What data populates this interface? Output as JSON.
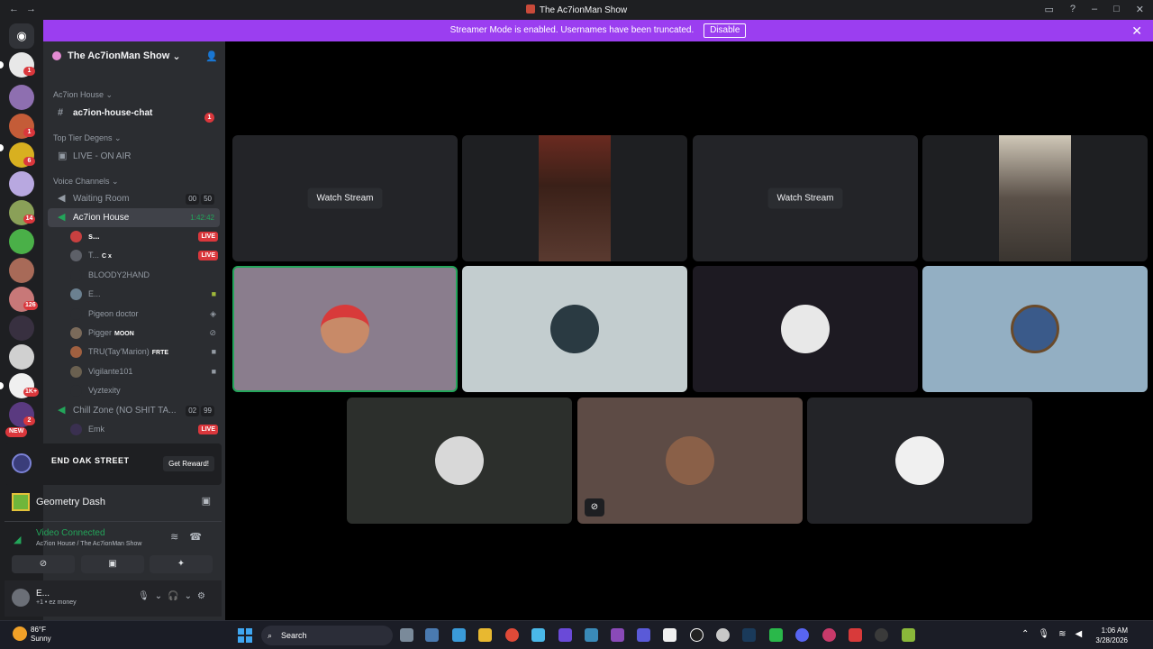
{
  "window": {
    "title": "The Ac7ionMan Show",
    "nav_back": "←",
    "nav_fwd": "→"
  },
  "banner": {
    "message": "Streamer Mode is enabled. Usernames have been truncated.",
    "button": "Disable",
    "close": "✕"
  },
  "rail": {
    "badges": [
      "1",
      "1",
      "6",
      "14",
      "126",
      "1K+",
      "2"
    ],
    "new_label": "NEW"
  },
  "server": {
    "name": "The Ac7ionMan Show",
    "chevron": "⌄"
  },
  "categories": {
    "house": "Ac7ion House",
    "top": "Top Tier Degens",
    "voice": "Voice Channels"
  },
  "channels": {
    "house_chat": {
      "name": "ac7ion-house-chat",
      "unread": "1"
    },
    "live_on_air": "LIVE - ON AIR",
    "waiting": {
      "name": "Waiting Room",
      "count": "00",
      "limit": "50"
    },
    "active": {
      "name": "Ac7ion House",
      "timer": "1:42:42"
    },
    "chill": {
      "name": "Chill Zone (NO SHIT TA...",
      "count": "02",
      "limit": "99"
    }
  },
  "voice_users": [
    {
      "name": "s...",
      "tag": "",
      "live": "LIVE"
    },
    {
      "name": "T...",
      "tag": "C x",
      "live": "LIVE"
    },
    {
      "name": "BLOODY2HAND",
      "tag": "",
      "live": ""
    },
    {
      "name": "E...",
      "tag": "",
      "live": ""
    },
    {
      "name": "Pigeon doctor",
      "tag": "",
      "live": ""
    },
    {
      "name": "Pigger",
      "tag": "MOON",
      "live": ""
    },
    {
      "name": "TRU(Tay'Marion)",
      "tag": "FRTE",
      "live": ""
    },
    {
      "name": "Vigilante101",
      "tag": "",
      "live": ""
    },
    {
      "name": "Vyztexity",
      "tag": "",
      "live": ""
    }
  ],
  "chill_users": [
    {
      "name": "Emk",
      "live": "LIVE"
    }
  ],
  "promo": {
    "brand": "END OAK STREET",
    "button": "Get Reward!"
  },
  "game": {
    "name": "Geometry Dash"
  },
  "voice_status": {
    "label": "Video Connected",
    "location": "Ac7ion House / The Ac7ionMan Show"
  },
  "user_panel": {
    "name": "E...",
    "status": "+1 • ez money"
  },
  "stage": {
    "watch_label": "Watch Stream"
  },
  "taskbar": {
    "temp": "86°F",
    "weather": "Sunny",
    "search": "Search",
    "time": "1:06 AM",
    "date": "3/28/2026"
  },
  "colors": {
    "blurple": "#5865f2",
    "streamer_banner": "#9b3ef0",
    "live_red": "#da373c",
    "connected_green": "#23a55a"
  }
}
